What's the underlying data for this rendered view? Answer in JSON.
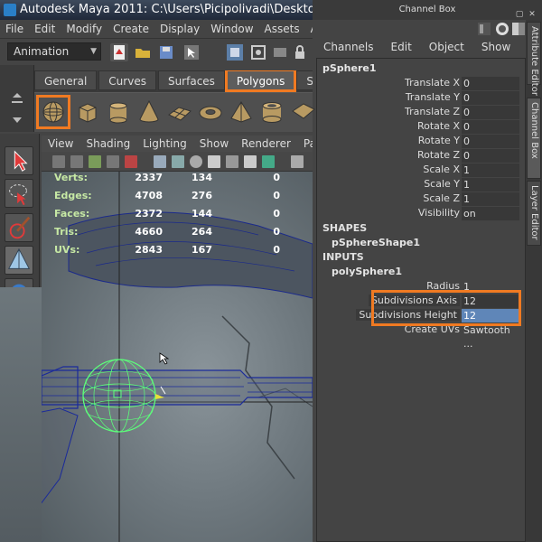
{
  "window": {
    "title": "Autodesk Maya 2011: C:\\Users\\Picipolivadi\\Desktop\\Tutorial\\"
  },
  "menubar": [
    "File",
    "Edit",
    "Modify",
    "Create",
    "Display",
    "Window",
    "Assets",
    "Anima"
  ],
  "status_line": {
    "mode": "Animation"
  },
  "shelf": {
    "tabs": [
      "General",
      "Curves",
      "Surfaces",
      "Polygons",
      "Subdivs"
    ],
    "active_tab": "Polygons",
    "buttons": [
      "poly-sphere-icon",
      "poly-cube-icon",
      "poly-cylinder-icon",
      "poly-cone-icon",
      "poly-plane-icon",
      "poly-torus-icon",
      "poly-pyramid-icon",
      "poly-pipe-icon",
      "poly-helix-icon"
    ]
  },
  "panel_menu": [
    "View",
    "Shading",
    "Lighting",
    "Show",
    "Renderer",
    "Panels"
  ],
  "hud": {
    "rows": [
      {
        "label": "Verts:",
        "v1": "2337",
        "v2": "134",
        "v3": "0"
      },
      {
        "label": "Edges:",
        "v1": "4708",
        "v2": "276",
        "v3": "0"
      },
      {
        "label": "Faces:",
        "v1": "2372",
        "v2": "144",
        "v3": "0"
      },
      {
        "label": "Tris:",
        "v1": "4660",
        "v2": "264",
        "v3": "0"
      },
      {
        "label": "UVs:",
        "v1": "2843",
        "v2": "167",
        "v3": "0"
      }
    ]
  },
  "channel_box": {
    "header": "Channel Box",
    "menu": [
      "Channels",
      "Edit",
      "Object",
      "Show"
    ],
    "node": "pSphere1",
    "attributes": [
      {
        "name": "Translate X",
        "value": "0"
      },
      {
        "name": "Translate Y",
        "value": "0"
      },
      {
        "name": "Translate Z",
        "value": "0"
      },
      {
        "name": "Rotate X",
        "value": "0"
      },
      {
        "name": "Rotate Y",
        "value": "0"
      },
      {
        "name": "Rotate Z",
        "value": "0"
      },
      {
        "name": "Scale X",
        "value": "1"
      },
      {
        "name": "Scale Y",
        "value": "1"
      },
      {
        "name": "Scale Z",
        "value": "1"
      },
      {
        "name": "Visibility",
        "value": "on"
      }
    ],
    "shapes_label": "SHAPES",
    "shape_node": "pSphereShape1",
    "inputs_label": "INPUTS",
    "input_node": "polySphere1",
    "input_attributes": [
      {
        "name": "Radius",
        "value": "1"
      },
      {
        "name": "Subdivisions Axis",
        "value": "12"
      },
      {
        "name": "Subdivisions Height",
        "value": "12"
      },
      {
        "name": "Create UVs",
        "value": "Sawtooth ..."
      }
    ]
  },
  "side_tabs": [
    "Attribute Editor",
    "Channel Box",
    "Layer Editor"
  ],
  "colors": {
    "highlight": "#f07a22",
    "wireframe_selected": "#5cff7a",
    "wireframe": "#1a2a9a"
  }
}
